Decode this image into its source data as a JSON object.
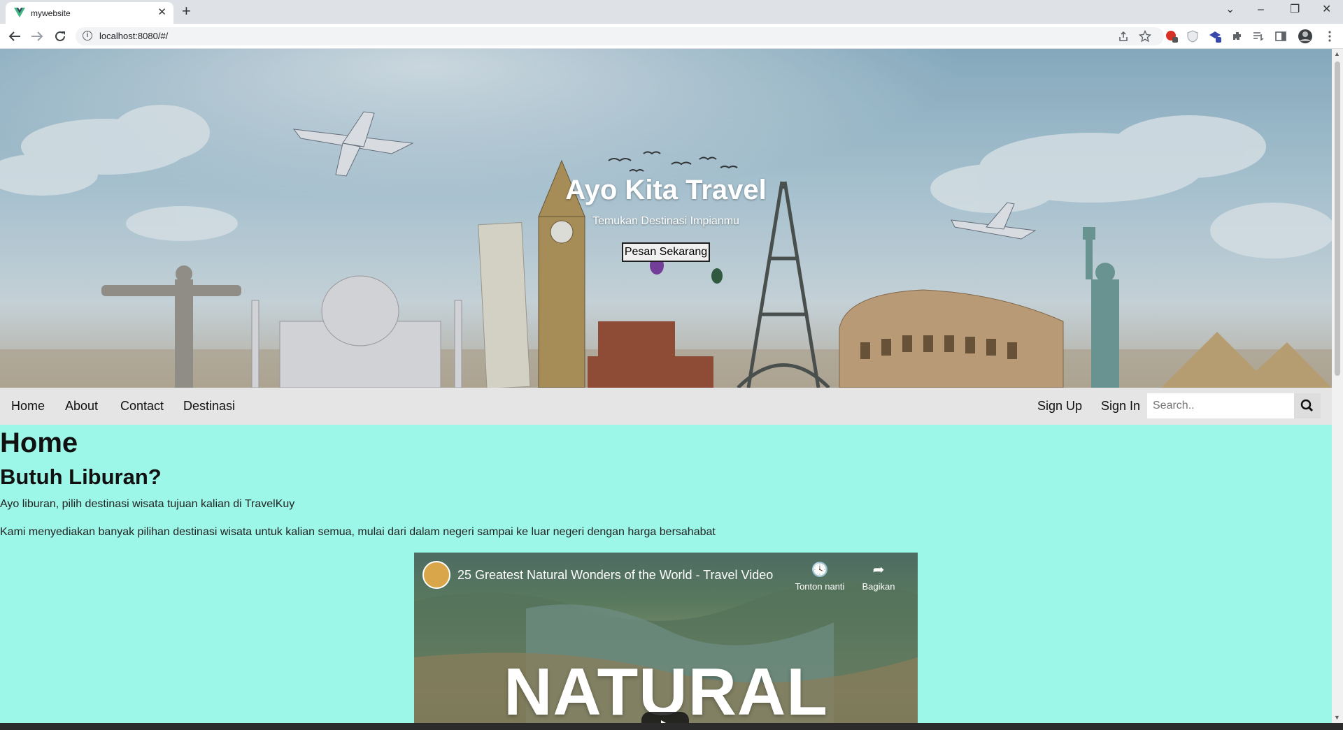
{
  "browser": {
    "tab_title": "mywebsite",
    "tab_close": "✕",
    "new_tab": "+",
    "url": "localhost:8080/#/",
    "window_controls": [
      "⌄",
      "–",
      "❐",
      "✕"
    ],
    "icons": [
      "back-icon",
      "forward-icon",
      "reload-icon",
      "share-icon",
      "bookmark-star-icon",
      "extensions-icon",
      "profile-avatar-icon",
      "menu-icon"
    ]
  },
  "hero": {
    "title": "Ayo Kita Travel",
    "subtitle": "Temukan Destinasi Impianmu",
    "cta_label": "Pesan Sekarang"
  },
  "nav": {
    "items": [
      {
        "label": "Home"
      },
      {
        "label": "About"
      },
      {
        "label": "Contact"
      },
      {
        "label": "Destinasi"
      }
    ],
    "sign_up": "Sign Up",
    "sign_in": "Sign In",
    "search_placeholder": "Search.."
  },
  "content": {
    "heading": "Home",
    "subheading": "Butuh Liburan?",
    "paragraph1": "Ayo liburan, pilih destinasi wisata tujuan kalian di TravelKuy",
    "paragraph2": "Kami menyediakan banyak pilihan destinasi wisata untuk kalian semua, mulai dari dalam negeri sampai ke luar negeri dengan harga bersahabat"
  },
  "video": {
    "title": "25 Greatest Natural Wonders of the World - Travel Video",
    "watch_later": "Tonton nanti",
    "share": "Bagikan",
    "overlay_text": "NATURAL"
  }
}
